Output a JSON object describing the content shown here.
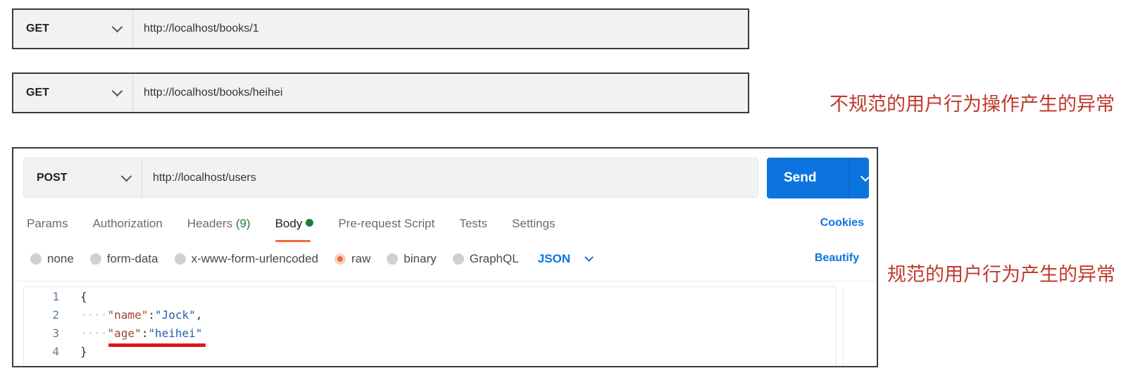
{
  "request1": {
    "method": "GET",
    "url": "http://localhost/books/1"
  },
  "request2": {
    "method": "GET",
    "url": "http://localhost/books/heihei"
  },
  "annotation_irregular": "不规范的用户行为操作产生的异常",
  "annotation_regular": "规范的用户行为产生的异常",
  "postman": {
    "method": "POST",
    "url": "http://localhost/users",
    "send_label": "Send",
    "tabs": {
      "params": "Params",
      "authorization": "Authorization",
      "headers": "Headers",
      "headers_count": "(9)",
      "body": "Body",
      "pre_request": "Pre-request Script",
      "tests": "Tests",
      "settings": "Settings"
    },
    "cookies_label": "Cookies",
    "body_types": {
      "none": "none",
      "form_data": "form-data",
      "urlencoded": "x-www-form-urlencoded",
      "raw": "raw",
      "binary": "binary",
      "graphql": "GraphQL"
    },
    "selected_body_type": "raw",
    "format": "JSON",
    "beautify_label": "Beautify",
    "editor": {
      "line_numbers": [
        "1",
        "2",
        "3",
        "4"
      ],
      "open_brace": "{",
      "close_brace": "}",
      "key1": "\"name\"",
      "val1": "\"Jock\"",
      "key2": "\"age\"",
      "val2": "\"heihei\"",
      "colon": ":",
      "comma": ",",
      "indent": "····"
    },
    "accent_color": "#0b74de",
    "active_tab_color": "#f26b3a"
  }
}
